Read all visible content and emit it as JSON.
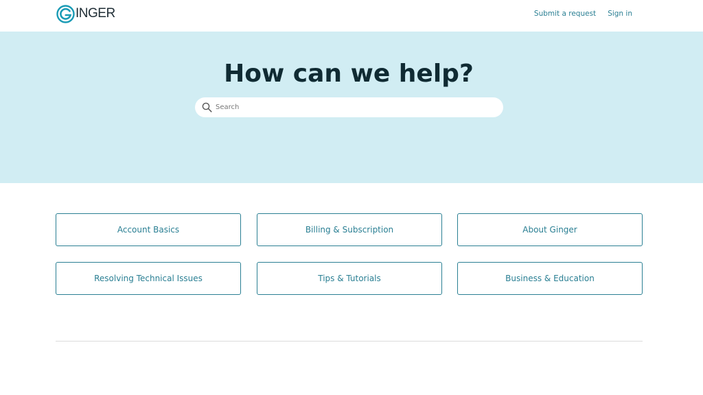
{
  "header": {
    "logo_text": "INGER",
    "nav": {
      "submit_request": "Submit a request",
      "sign_in": "Sign in"
    }
  },
  "hero": {
    "title": "How can we help?",
    "search": {
      "placeholder": "Search",
      "value": ""
    }
  },
  "categories": [
    {
      "label": "Account Basics"
    },
    {
      "label": "Billing & Subscription"
    },
    {
      "label": "About Ginger"
    },
    {
      "label": "Resolving Technical Issues"
    },
    {
      "label": "Tips & Tutorials"
    },
    {
      "label": "Business & Education"
    }
  ],
  "colors": {
    "hero_bg": "#d1edf3",
    "accent": "#2a7f93",
    "title": "#102b33",
    "logo_teal": "#1a9bb5"
  },
  "icons": {
    "logo": "ginger-logo-icon",
    "search": "search-icon"
  }
}
